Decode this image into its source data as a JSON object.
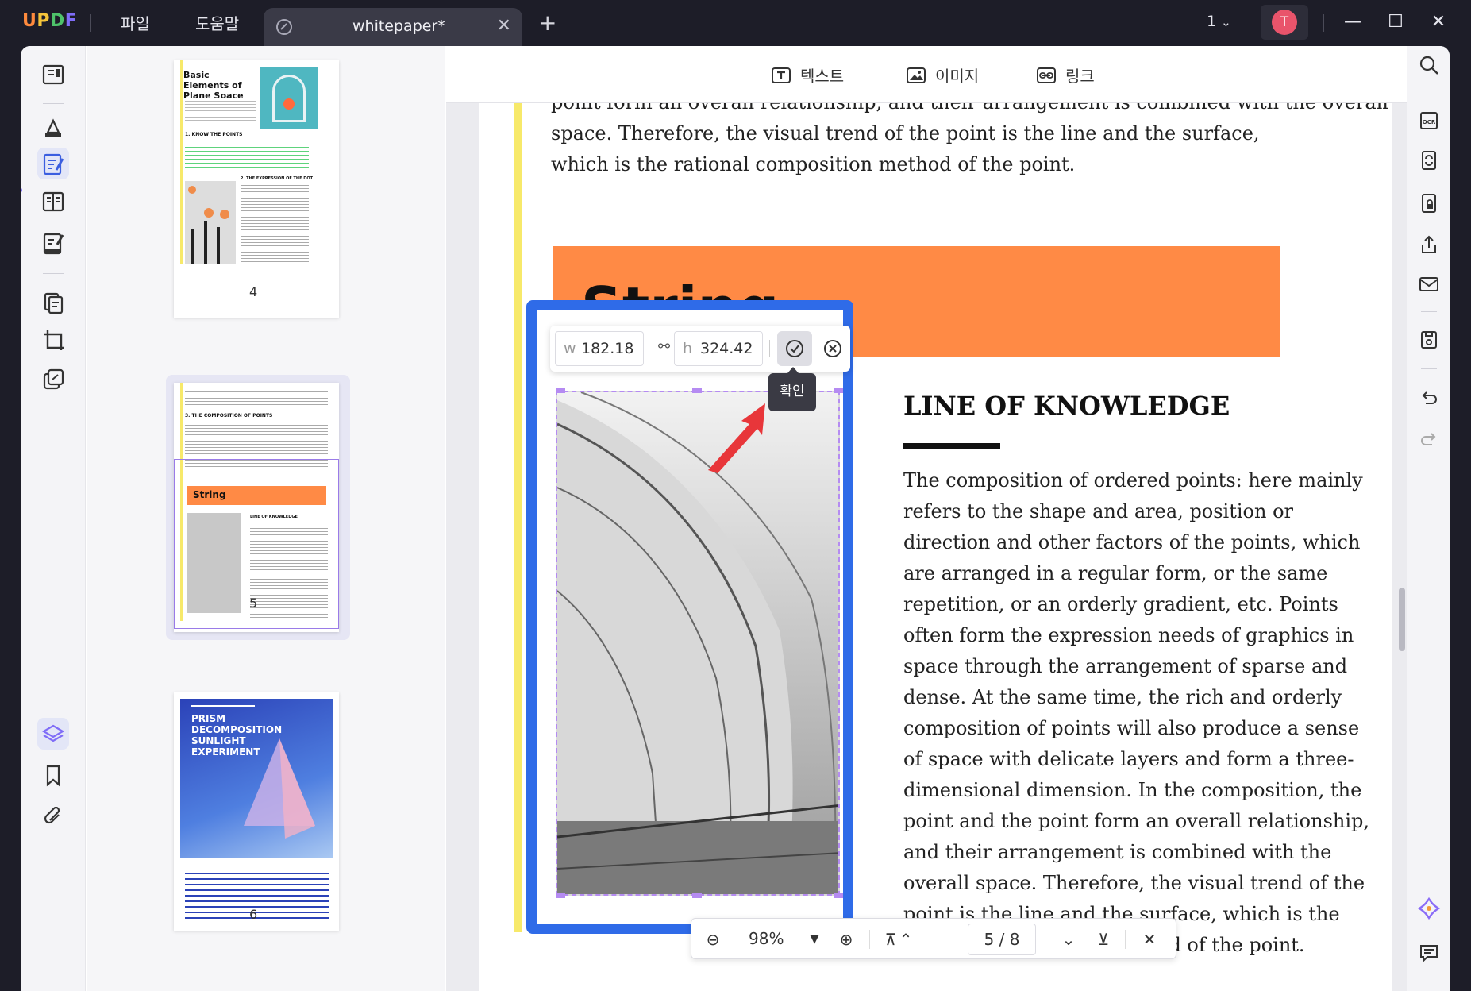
{
  "titlebar": {
    "logo": [
      "U",
      "P",
      "D",
      "F"
    ],
    "menu_file": "파일",
    "menu_help": "도움말",
    "tab_title": "whitepaper*",
    "tab_close": "✕",
    "tab_add": "+",
    "page_indicator": "1",
    "avatar_initial": "T",
    "minimize": "—",
    "maximize": "☐",
    "close": "✕"
  },
  "top_tools": {
    "text": "텍스트",
    "image": "이미지",
    "link": "링크"
  },
  "page": {
    "para_top": "space. Therefore, the visual trend of the point is the line and the surface, which is the rational composition method of the point.",
    "para_top_line0": "point form an overall relationship, and their arrangement is combined with the overall",
    "string_title": "String",
    "heading": "LINE OF KNOWLEDGE",
    "paragraph_lines": [
      "The composition of ordered points: here mainly",
      "refers to the shape and area, position or",
      "direction and other factors of the points, which",
      "are arranged in a regular form, or the same",
      "repetition, or an orderly gradient, etc. Points",
      "often form the expression needs of graphics in",
      "space through the arrangement of sparse and",
      "dense. At the same time, the rich and orderly",
      "composition of points will also produce a sense",
      "of space with delicate layers and form a three-",
      "dimensional dimension. In the composition, the",
      "point and the point form an overall relationship,",
      "and their arrangement is combined with the",
      "overall space. Therefore, the visual trend of the",
      "point is the line and the surface, which is the",
      "rational composition method of the point."
    ]
  },
  "image_edit": {
    "w_label": "w",
    "w_value": "182.18",
    "h_label": "h",
    "h_value": "324.42",
    "confirm_tooltip": "확인"
  },
  "bottom_bar": {
    "zoom": "98%",
    "current_page": "5",
    "page_sep": "/",
    "total_pages": "8"
  },
  "thumbnails": [
    {
      "number": "4",
      "title": "Basic Elements of Plane Space",
      "section1": "1. KNOW THE POINTS",
      "section2": "2. THE EXPRESSION OF THE DOT"
    },
    {
      "number": "5",
      "section": "3. THE COMPOSITION OF POINTS",
      "banner": "String",
      "subhead": "LINE OF KNOWLEDGE"
    },
    {
      "number": "6",
      "title": "PRISM DECOMPOSITION SUNLIGHT EXPERIMENT"
    }
  ],
  "colors": {
    "accent_blue": "#2f6be8",
    "orange": "#ff8a45",
    "yellow_bar": "#f7e96a",
    "selection_purple": "#b58bf2",
    "avatar": "#e9546b"
  }
}
